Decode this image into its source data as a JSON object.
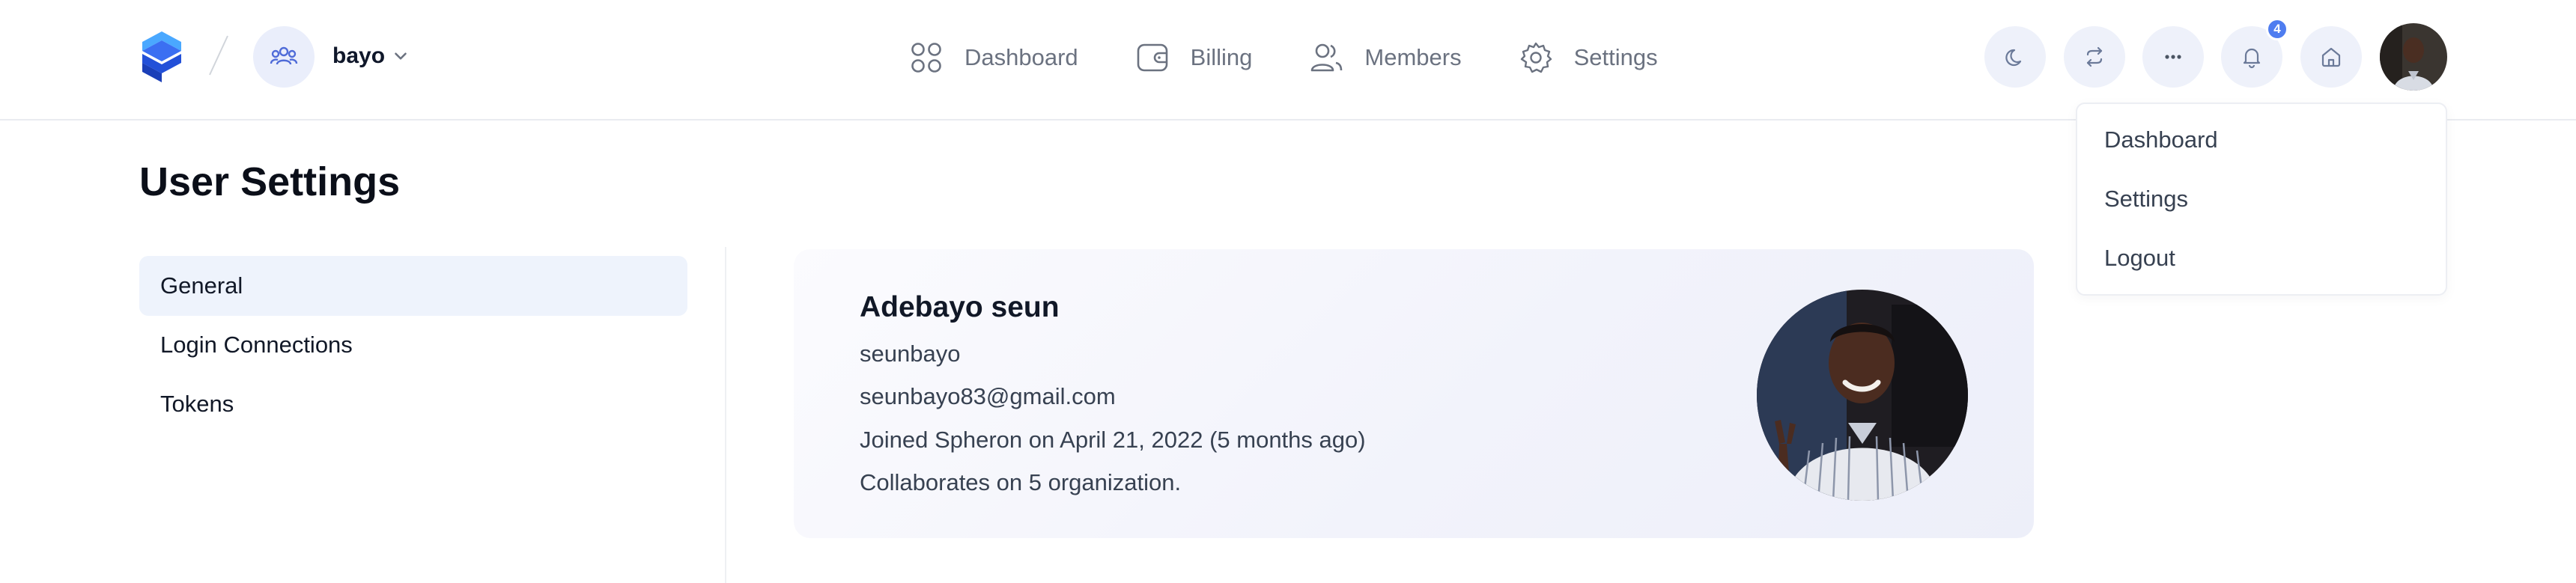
{
  "brand": {
    "accent": "#4f7df0"
  },
  "org": {
    "name": "bayo"
  },
  "nav": {
    "items": [
      {
        "label": "Dashboard",
        "icon": "grid-icon"
      },
      {
        "label": "Billing",
        "icon": "wallet-icon"
      },
      {
        "label": "Members",
        "icon": "users-icon"
      },
      {
        "label": "Settings",
        "icon": "gear-icon"
      }
    ]
  },
  "toolbar": {
    "buttons": [
      "moon-icon",
      "refresh-icon",
      "more-icon",
      "bell-icon",
      "home-icon"
    ],
    "notification_count": "4"
  },
  "user_menu": {
    "items": [
      {
        "label": "Dashboard"
      },
      {
        "label": "Settings"
      },
      {
        "label": "Logout"
      }
    ]
  },
  "page": {
    "title": "User Settings"
  },
  "sidebar": {
    "items": [
      {
        "label": "General",
        "active": true
      },
      {
        "label": "Login Connections",
        "active": false
      },
      {
        "label": "Tokens",
        "active": false
      }
    ]
  },
  "profile": {
    "name": "Adebayo seun",
    "username": "seunbayo",
    "email": "seunbayo83@gmail.com",
    "joined": "Joined Spheron on April 21, 2022 (5 months ago)",
    "collaborates": "Collaborates on 5 organization."
  }
}
